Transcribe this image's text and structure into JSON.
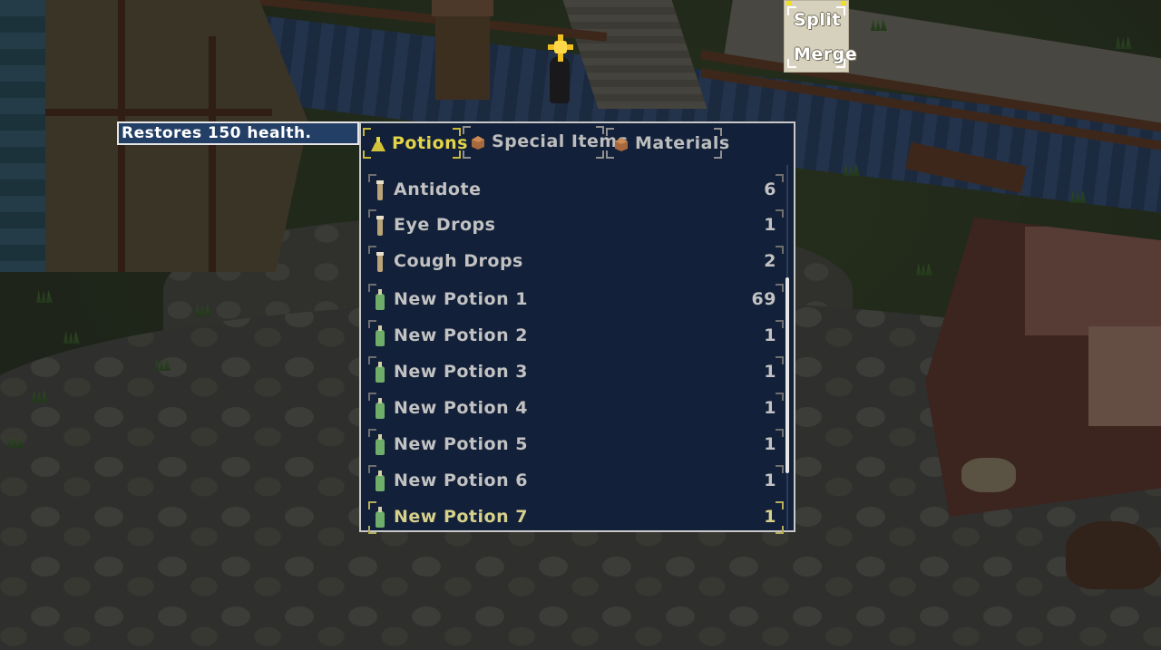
{
  "colors": {
    "panel_bg": "#122039",
    "tooltip_bg": "#233f66",
    "active_tab": "#e3d448",
    "text": "#c2c2c2",
    "selected_text": "#d6d08a",
    "quest_marker": "#f0c020",
    "split_merge_bg": "#d6d1bd"
  },
  "split_merge": {
    "split_label": "Split",
    "merge_label": "Merge"
  },
  "tooltip": {
    "text": "Restores 150 health."
  },
  "tabs": [
    {
      "label": "Potions",
      "icon": "potion-flask-icon",
      "active": true
    },
    {
      "label": "Special Items",
      "icon": "bag-icon",
      "active": false
    },
    {
      "label": "Materials",
      "icon": "bag-icon",
      "active": false
    }
  ],
  "items": [
    {
      "name": "Antidote",
      "qty": "6",
      "icon": "vial-icon"
    },
    {
      "name": "Eye Drops",
      "qty": "1",
      "icon": "vial-icon"
    },
    {
      "name": "Cough Drops",
      "qty": "2",
      "icon": "vial-icon"
    },
    {
      "name": "New Potion 1",
      "qty": "69",
      "icon": "green-bottle-icon"
    },
    {
      "name": "New Potion 2",
      "qty": "1",
      "icon": "green-bottle-icon"
    },
    {
      "name": "New Potion 3",
      "qty": "1",
      "icon": "green-bottle-icon"
    },
    {
      "name": "New Potion 4",
      "qty": "1",
      "icon": "green-bottle-icon"
    },
    {
      "name": "New Potion 5",
      "qty": "1",
      "icon": "green-bottle-icon"
    },
    {
      "name": "New Potion 6",
      "qty": "1",
      "icon": "green-bottle-icon"
    },
    {
      "name": "New Potion 7",
      "qty": "1",
      "icon": "green-bottle-icon",
      "selected": true
    }
  ]
}
